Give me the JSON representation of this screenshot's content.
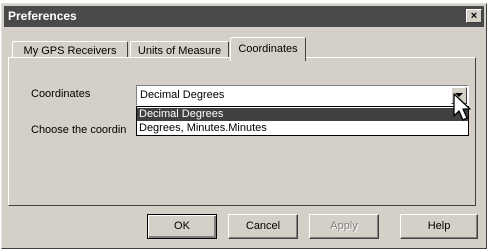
{
  "window": {
    "title": "Preferences",
    "close_glyph": "×"
  },
  "tabs": [
    {
      "label": "My GPS Receivers",
      "active": false
    },
    {
      "label": "Units of Measure",
      "active": false
    },
    {
      "label": "Coordinates",
      "active": true
    }
  ],
  "panel": {
    "coordinates_label": "Coordinates",
    "combo_value": "Decimal Degrees",
    "choose_label": "Choose the coordin",
    "dropdown_options": [
      "Decimal Degrees",
      "Degrees, Minutes.Minutes"
    ],
    "selected_option": 0
  },
  "buttons": {
    "ok": "OK",
    "cancel": "Cancel",
    "apply": "Apply",
    "help": "Help"
  },
  "colors": {
    "titlebar": "#4a4a4a",
    "dialog_face": "#d4d0c8",
    "selection": "#404040"
  }
}
